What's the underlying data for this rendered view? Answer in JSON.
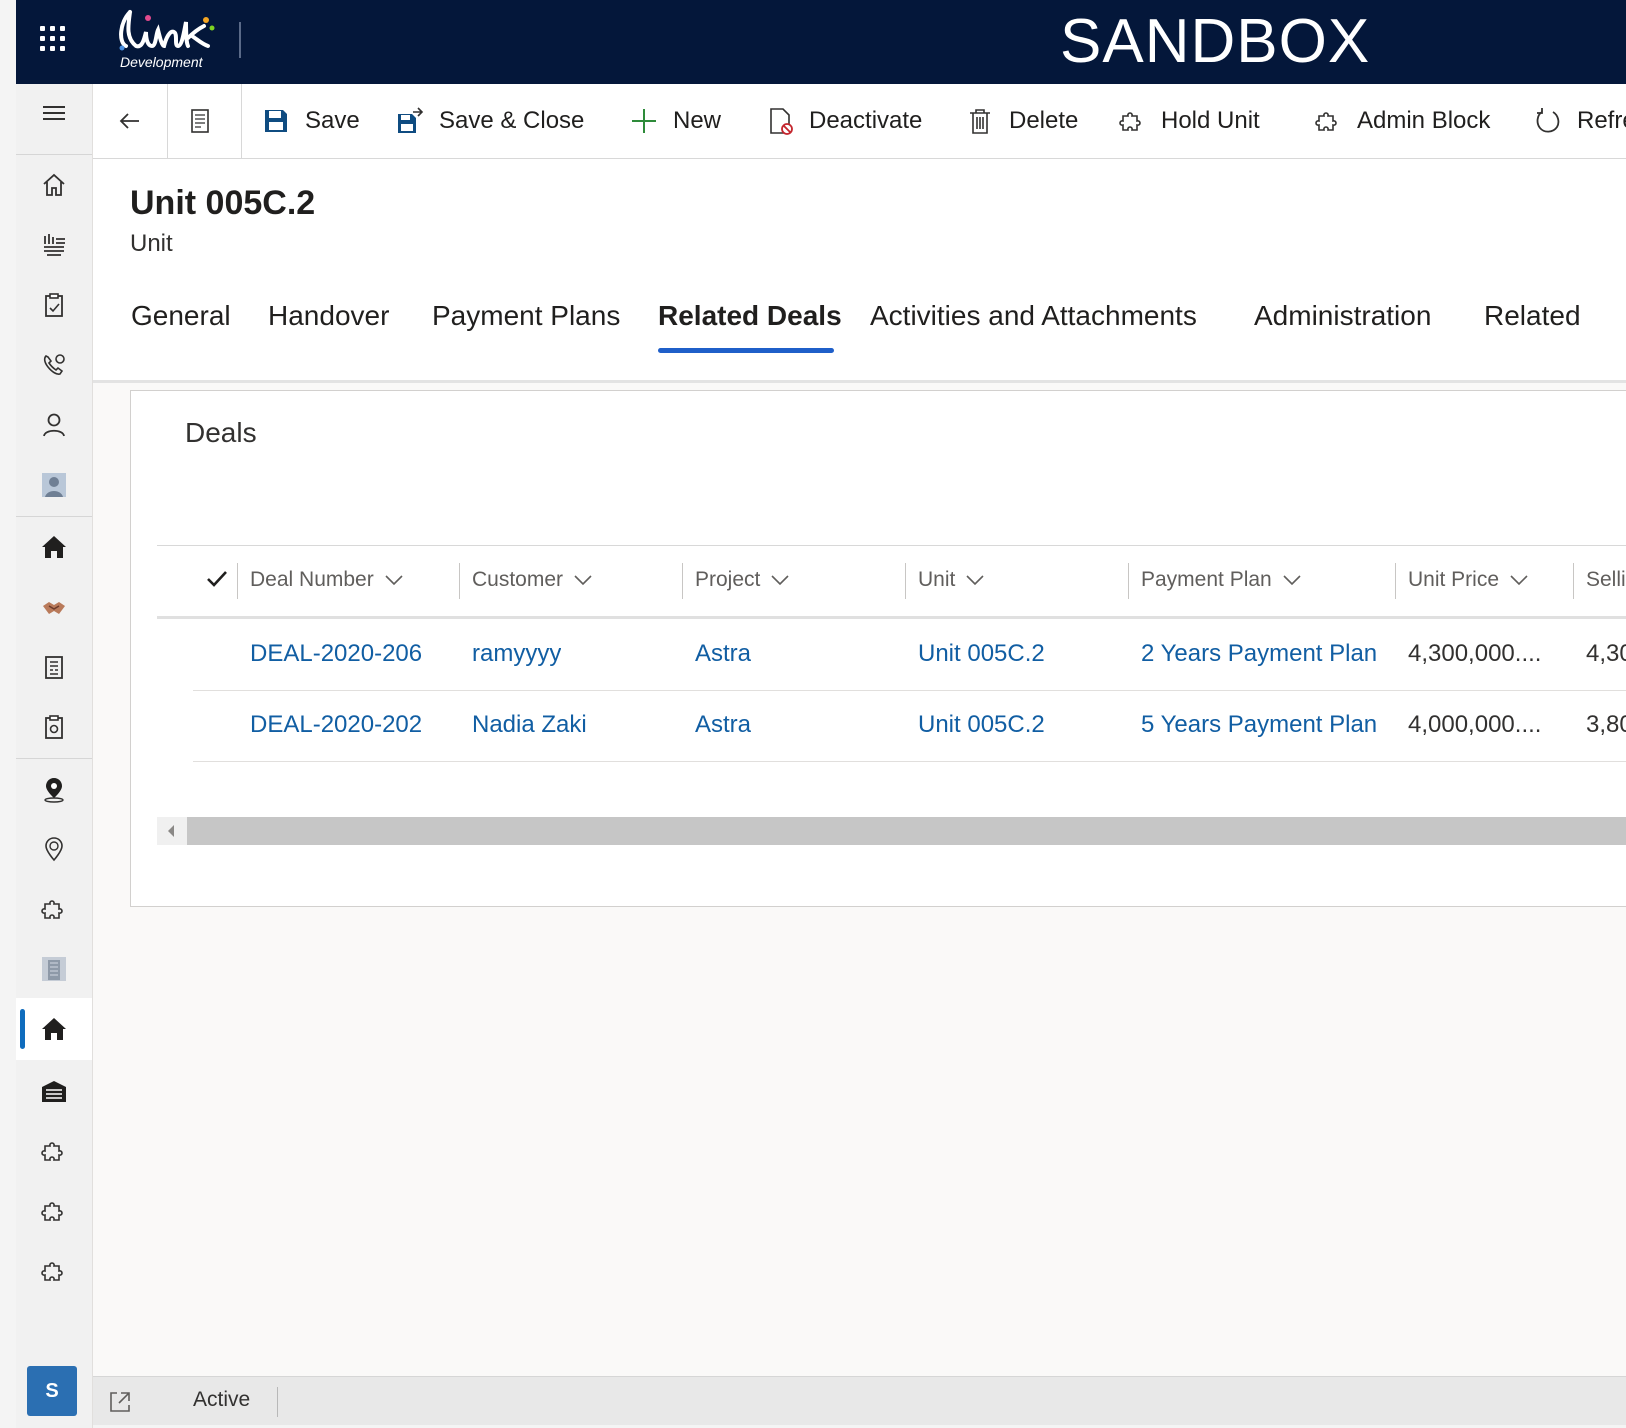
{
  "header": {
    "environment": "SANDBOX",
    "logo_text": "Development",
    "logo_mark": "link"
  },
  "commands": {
    "save": "Save",
    "save_close": "Save & Close",
    "new": "New",
    "deactivate": "Deactivate",
    "delete": "Delete",
    "hold_unit": "Hold Unit",
    "admin_block": "Admin Block",
    "refresh": "Refre"
  },
  "record": {
    "title": "Unit 005C.2",
    "type": "Unit"
  },
  "tabs": [
    "General",
    "Handover",
    "Payment Plans",
    "Related Deals",
    "Activities and Attachments",
    "Administration",
    "Related"
  ],
  "active_tab": "Related Deals",
  "deals": {
    "title": "Deals",
    "columns": [
      "Deal Number",
      "Customer",
      "Project",
      "Unit",
      "Payment Plan",
      "Unit Price",
      "Selli"
    ],
    "rows": [
      {
        "deal_number": "DEAL-2020-206",
        "customer": "ramyyyy",
        "project": "Astra",
        "unit": "Unit 005C.2",
        "payment_plan": "2 Years Payment Plan",
        "unit_price": "4,300,000....",
        "selling": "4,30"
      },
      {
        "deal_number": "DEAL-2020-202",
        "customer": "Nadia Zaki",
        "project": "Astra",
        "unit": "Unit 005C.2",
        "payment_plan": "5 Years Payment Plan",
        "unit_price": "4,000,000....",
        "selling": "3,80"
      }
    ]
  },
  "footer": {
    "status": "Active"
  },
  "user": {
    "initial": "S"
  },
  "colors": {
    "topbar": "#04173a",
    "link": "#115ea3",
    "accent": "#1f5fc9",
    "avatar": "#2b6fb2"
  }
}
